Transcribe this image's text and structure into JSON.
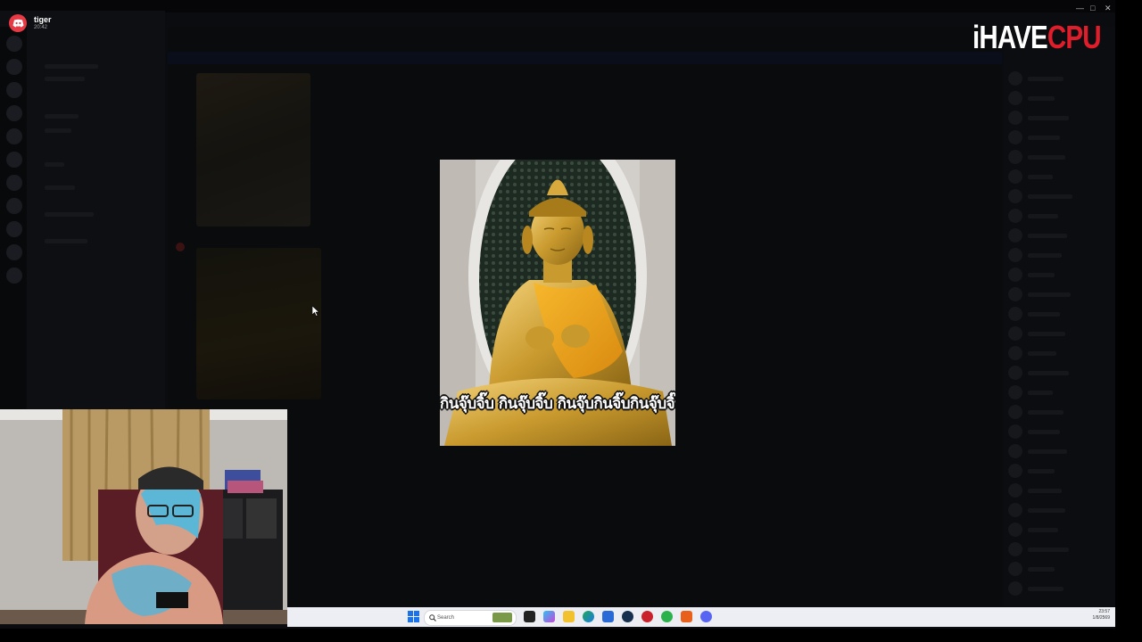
{
  "notification": {
    "app_icon": "discord-icon",
    "sender": "tiger",
    "time": "20:42"
  },
  "brand": {
    "part1": "iHAVE",
    "part2": "CPU",
    "colors": {
      "white": "#ffffff",
      "red": "#e01e2b"
    }
  },
  "viewer": {
    "caption": "กินจุ๊บจิ๊บ กินจุ๊บจิ๊บ กินจุ๊บกินจิ๊บกินจุ๊บจิ๊บ",
    "image_subject": "golden-buddha-statue"
  },
  "taskbar": {
    "search_label": "Search",
    "icons": [
      "start-icon",
      "search-icon",
      "app-icon",
      "task-view-icon",
      "copilot-icon",
      "file-explorer-icon",
      "edge-icon",
      "store-icon",
      "steam-icon",
      "app-icon",
      "app-icon",
      "app-icon",
      "discord-icon"
    ],
    "tray_time": "23:57",
    "tray_date": "1/8/2569"
  },
  "colors": {
    "discord_red": "#e63a44",
    "taskbar_bg": "#eceef3"
  }
}
